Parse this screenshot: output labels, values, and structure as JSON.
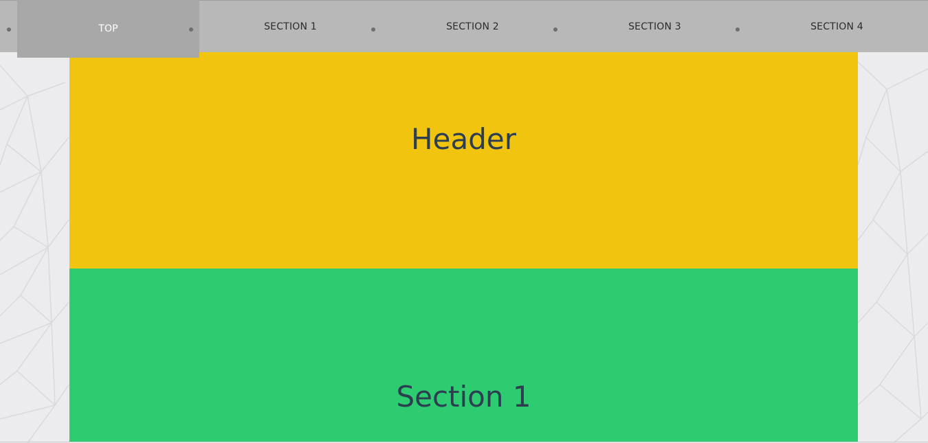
{
  "nav": {
    "items": [
      {
        "label": "TOP",
        "active": true
      },
      {
        "label": "SECTION 1",
        "active": false
      },
      {
        "label": "SECTION 2",
        "active": false
      },
      {
        "label": "SECTION 3",
        "active": false
      },
      {
        "label": "SECTION 4",
        "active": false
      }
    ]
  },
  "header": {
    "title": "Header",
    "color": "#f1c40f"
  },
  "section1": {
    "title": "Section 1",
    "color": "#2ecc71"
  },
  "colors": {
    "nav_bg": "#b8b8b8",
    "nav_active_bg": "#a8a8a8",
    "text_dark": "#2c3e50",
    "page_bg": "#ececee"
  }
}
